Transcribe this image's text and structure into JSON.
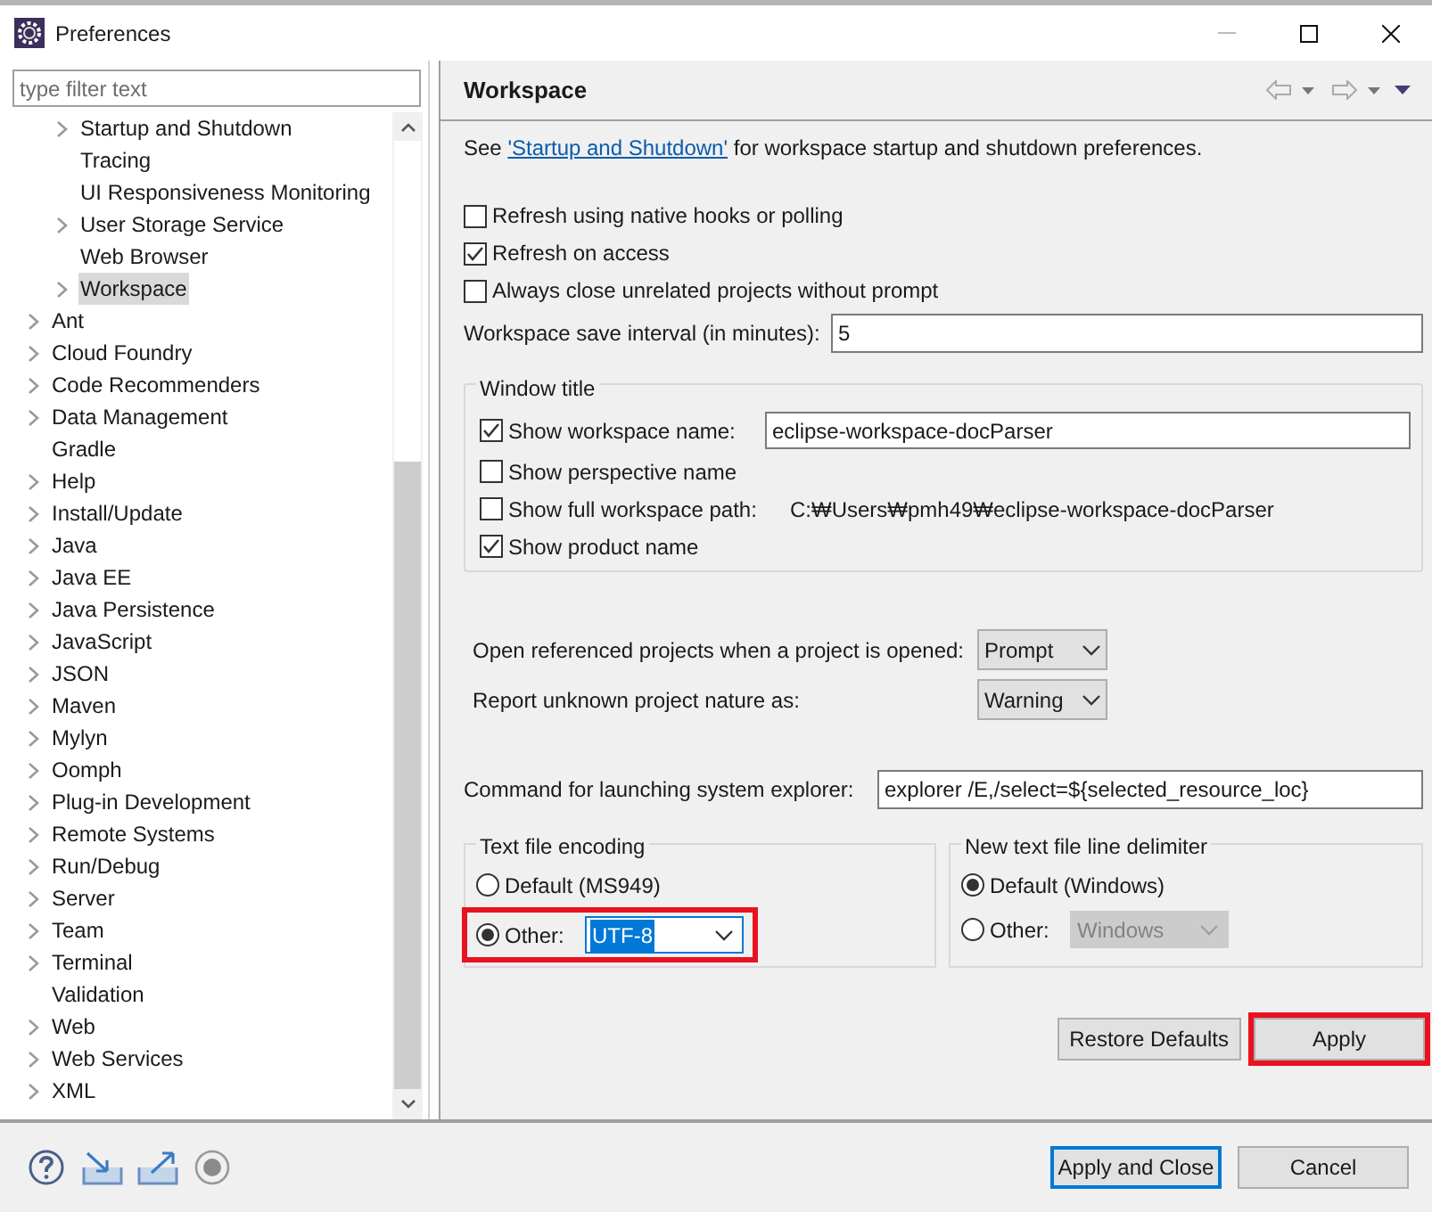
{
  "window": {
    "title": "Preferences"
  },
  "filter": {
    "placeholder": "type filter text"
  },
  "tree": [
    {
      "children": [
        {
          "label": "Startup and Shutdown",
          "expandable": true,
          "selected": false
        },
        {
          "label": "Tracing",
          "expandable": false,
          "selected": false
        },
        {
          "label": "UI Responsiveness Monitoring",
          "expandable": false,
          "selected": false
        },
        {
          "label": "User Storage Service",
          "expandable": true,
          "selected": false
        },
        {
          "label": "Web Browser",
          "expandable": false,
          "selected": false
        },
        {
          "label": "Workspace",
          "expandable": true,
          "selected": true
        }
      ]
    },
    {
      "label": "Ant",
      "expandable": true,
      "selected": false
    },
    {
      "label": "Cloud Foundry",
      "expandable": true,
      "selected": false
    },
    {
      "label": "Code Recommenders",
      "expandable": true,
      "selected": false
    },
    {
      "label": "Data Management",
      "expandable": true,
      "selected": false
    },
    {
      "label": "Gradle",
      "expandable": false,
      "selected": false
    },
    {
      "label": "Help",
      "expandable": true,
      "selected": false
    },
    {
      "label": "Install/Update",
      "expandable": true,
      "selected": false
    },
    {
      "label": "Java",
      "expandable": true,
      "selected": false
    },
    {
      "label": "Java EE",
      "expandable": true,
      "selected": false
    },
    {
      "label": "Java Persistence",
      "expandable": true,
      "selected": false
    },
    {
      "label": "JavaScript",
      "expandable": true,
      "selected": false
    },
    {
      "label": "JSON",
      "expandable": true,
      "selected": false
    },
    {
      "label": "Maven",
      "expandable": true,
      "selected": false
    },
    {
      "label": "Mylyn",
      "expandable": true,
      "selected": false
    },
    {
      "label": "Oomph",
      "expandable": true,
      "selected": false
    },
    {
      "label": "Plug-in Development",
      "expandable": true,
      "selected": false
    },
    {
      "label": "Remote Systems",
      "expandable": true,
      "selected": false
    },
    {
      "label": "Run/Debug",
      "expandable": true,
      "selected": false
    },
    {
      "label": "Server",
      "expandable": true,
      "selected": false
    },
    {
      "label": "Team",
      "expandable": true,
      "selected": false
    },
    {
      "label": "Terminal",
      "expandable": true,
      "selected": false
    },
    {
      "label": "Validation",
      "expandable": false,
      "selected": false
    },
    {
      "label": "Web",
      "expandable": true,
      "selected": false
    },
    {
      "label": "Web Services",
      "expandable": true,
      "selected": false
    },
    {
      "label": "XML",
      "expandable": true,
      "selected": false
    }
  ],
  "page": {
    "title": "Workspace",
    "intro": {
      "before": "See ",
      "link": "'Startup and Shutdown'",
      "after": " for workspace startup and shutdown preferences."
    },
    "checkboxes": [
      {
        "label": "Refresh using native hooks or polling",
        "checked": false
      },
      {
        "label": "Refresh on access",
        "checked": true
      },
      {
        "label": "Always close unrelated projects without prompt",
        "checked": false
      }
    ],
    "save_interval": {
      "label": "Workspace save interval (in minutes):",
      "value": "5"
    },
    "window_title": {
      "legend": "Window title",
      "rows": [
        {
          "kind": "field",
          "label": "Show workspace name:",
          "checked": true,
          "value": "eclipse-workspace-docParser"
        },
        {
          "kind": "plain",
          "label": "Show perspective name",
          "checked": false
        },
        {
          "kind": "path",
          "label": "Show full workspace path:",
          "checked": false,
          "text": "C:₩Users₩pmh49₩eclipse-workspace-docParser"
        },
        {
          "kind": "plain",
          "label": "Show product name",
          "checked": true
        }
      ]
    },
    "project_settings": [
      {
        "label": "Open referenced projects when a project is opened:",
        "value": "Prompt"
      },
      {
        "label": "Report unknown project nature as:",
        "value": "Warning"
      }
    ],
    "explorer_command": {
      "label": "Command for launching system explorer:",
      "value": "explorer /E,/select=${selected_resource_loc}"
    },
    "encoding": {
      "legend": "Text file encoding",
      "options": [
        {
          "kind": "radio",
          "label": "Default (MS949)",
          "selected": false
        },
        {
          "kind": "select",
          "label": "Other:",
          "selected": true,
          "value": "UTF-8",
          "value_highlighted": true,
          "disabled": false,
          "highlighted": true
        }
      ]
    },
    "line_delimiter": {
      "legend": "New text file line delimiter",
      "options": [
        {
          "kind": "radio",
          "label": "Default (Windows)",
          "selected": true
        },
        {
          "kind": "select",
          "label": "Other:",
          "selected": false,
          "value": "Windows",
          "value_highlighted": false,
          "disabled": true,
          "highlighted": false
        }
      ]
    },
    "buttons": [
      {
        "label": "Restore Defaults",
        "highlighted": false
      },
      {
        "label": "Apply",
        "highlighted": true
      }
    ]
  },
  "footer_buttons": [
    {
      "label": "Apply and Close",
      "default": true
    },
    {
      "label": "Cancel",
      "default": false
    }
  ]
}
